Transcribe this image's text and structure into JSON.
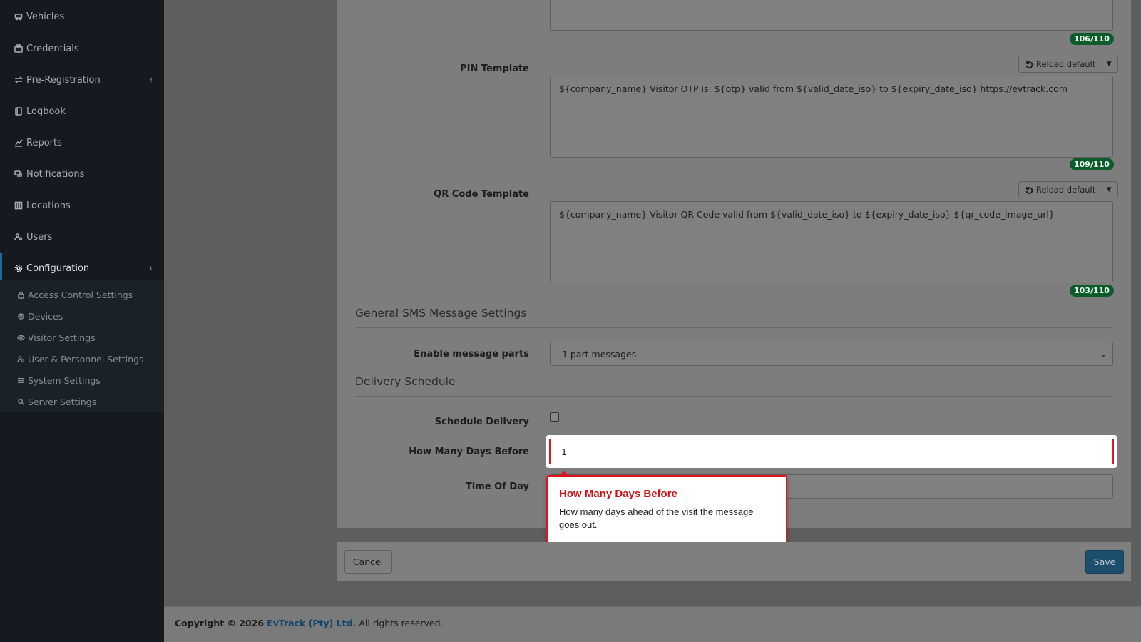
{
  "sidebar": {
    "items": [
      {
        "label": "Vehicles",
        "icon": "vehicle-icon"
      },
      {
        "label": "Credentials",
        "icon": "credentials-icon"
      },
      {
        "label": "Pre-Registration",
        "icon": "exchange-icon"
      },
      {
        "label": "Logbook",
        "icon": "book-icon"
      },
      {
        "label": "Reports",
        "icon": "chart-icon"
      },
      {
        "label": "Notifications",
        "icon": "comments-icon"
      },
      {
        "label": "Locations",
        "icon": "building-icon"
      },
      {
        "label": "Users",
        "icon": "users-icon"
      },
      {
        "label": "Configuration",
        "icon": "cog-icon"
      }
    ],
    "sub_items": [
      {
        "label": "Access Control Settings",
        "icon": "lock-icon"
      },
      {
        "label": "Devices",
        "icon": "device-icon"
      },
      {
        "label": "Visitor Settings",
        "icon": "eye-icon"
      },
      {
        "label": "User & Personnel Settings",
        "icon": "user-cog-icon"
      },
      {
        "label": "System Settings",
        "icon": "sliders-icon"
      },
      {
        "label": "Server Settings",
        "icon": "server-cog-icon"
      }
    ]
  },
  "form": {
    "top_counter": "106/110",
    "pin_template": {
      "label": "PIN Template",
      "reload_label": "Reload default",
      "value": "${company_name} Visitor OTP is: ${otp} valid from ${valid_date_iso} to ${expiry_date_iso} https://evtrack.com",
      "counter": "109/110"
    },
    "qr_template": {
      "label": "QR Code Template",
      "reload_label": "Reload default",
      "value": "${company_name} Visitor QR Code valid from ${valid_date_iso} to ${expiry_date_iso} ${qr_code_image_url}",
      "counter": "103/110"
    },
    "general_section_title": "General SMS Message Settings",
    "message_parts": {
      "label": "Enable message parts",
      "value": "1 part messages"
    },
    "delivery_section_title": "Delivery Schedule",
    "schedule_delivery": {
      "label": "Schedule Delivery",
      "checked": false
    },
    "days_before": {
      "label": "How Many Days Before",
      "value": "1"
    },
    "time_of_day": {
      "label": "Time Of Day",
      "value": ""
    }
  },
  "tooltip": {
    "title": "How Many Days Before",
    "body": "How many days ahead of the visit the message goes out."
  },
  "buttons": {
    "cancel": "Cancel",
    "save": "Save"
  },
  "footer": {
    "prefix": "Copyright © 2026",
    "company": "EvTrack (Pty) Ltd.",
    "suffix": "All rights reserved."
  },
  "colors": {
    "sidebar_bg": "#141a1f",
    "accent": "#1b6c99",
    "counter_badge": "#0b5b2b",
    "tooltip_border": "#e0161b",
    "save_button": "#1e4e6e"
  }
}
